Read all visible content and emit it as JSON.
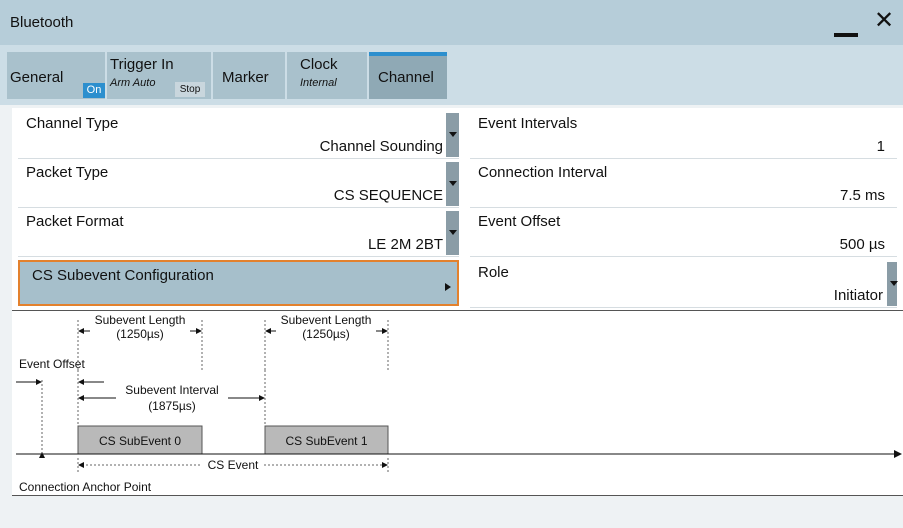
{
  "window": {
    "title": "Bluetooth"
  },
  "tabs": [
    {
      "label": "General",
      "badge": "On"
    },
    {
      "label": "Trigger In",
      "sub": "Arm Auto",
      "badge": "Stop"
    },
    {
      "label": "Marker"
    },
    {
      "label": "Clock",
      "sub": "Internal"
    },
    {
      "label": "Channel",
      "active": true
    }
  ],
  "left_fields": [
    {
      "label": "Channel Type",
      "value": "Channel Sounding"
    },
    {
      "label": "Packet Type",
      "value": "CS SEQUENCE"
    },
    {
      "label": "Packet Format",
      "value": "LE 2M 2BT"
    }
  ],
  "subevent_config": {
    "label": "CS Subevent Configuration"
  },
  "right_fields": [
    {
      "label": "Event Intervals",
      "value": "1"
    },
    {
      "label": "Connection Interval",
      "value": "7.5 ms"
    },
    {
      "label": "Event Offset",
      "value": "500 µs"
    },
    {
      "label": "Role",
      "value": "Initiator"
    }
  ],
  "diagram": {
    "subevent_length_1": {
      "label": "Subevent Length",
      "value": "(1250µs)"
    },
    "subevent_length_2": {
      "label": "Subevent Length",
      "value": "(1250µs)"
    },
    "event_offset": "Event Offset",
    "subevent_interval": {
      "label": "Subevent Interval",
      "value": "(1875µs)"
    },
    "subevent_0": "CS SubEvent 0",
    "subevent_1": "CS SubEvent 1",
    "cs_event": "CS Event",
    "anchor": "Connection Anchor Point"
  },
  "colors": {
    "accent": "#2c8fce",
    "highlight_border": "#e3812d",
    "selected_bg": "#a6bfcb"
  }
}
